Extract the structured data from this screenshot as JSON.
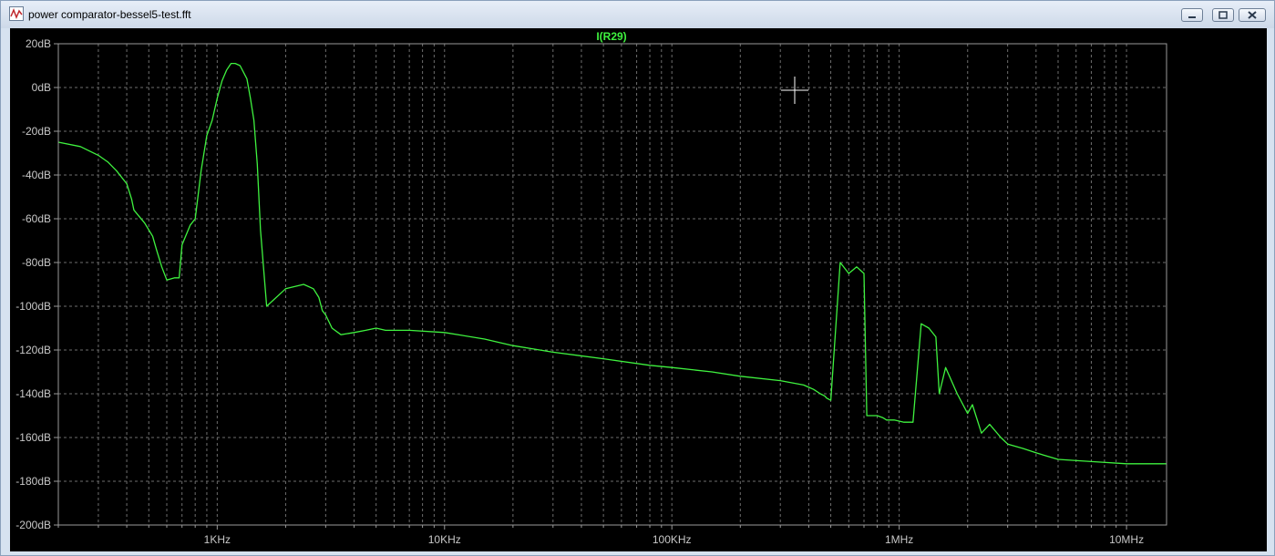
{
  "window": {
    "title": "power comparator-bessel5-test.fft"
  },
  "icons": {
    "app": "waveform-viewer-icon",
    "minimize": "minimize-icon",
    "maximize": "maximize-icon",
    "close": "close-icon"
  },
  "colors": {
    "background": "#000000",
    "trace": "#3ff23f",
    "axis_text": "#c8c8c8",
    "grid": "#6e6e6e",
    "cursor": "#ffffff"
  },
  "chart_data": {
    "type": "line",
    "title": "I(R29)",
    "x_scale": "log",
    "xlim": [
      200,
      15000000
    ],
    "ylim": [
      -200,
      20
    ],
    "y_ticks": [
      20,
      0,
      -20,
      -40,
      -60,
      -80,
      -100,
      -120,
      -140,
      -160,
      -180,
      -200
    ],
    "y_tick_labels": [
      "20dB",
      "0dB",
      "-20dB",
      "-40dB",
      "-60dB",
      "-80dB",
      "-100dB",
      "-120dB",
      "-140dB",
      "-160dB",
      "-180dB",
      "-200dB"
    ],
    "x_major_ticks": [
      1000,
      10000,
      100000,
      1000000,
      10000000
    ],
    "x_tick_labels": [
      "1KHz",
      "10KHz",
      "100KHz",
      "1MHz",
      "10MHz"
    ],
    "grid": true,
    "series": [
      {
        "name": "I(R29)",
        "x": [
          200,
          250,
          300,
          330,
          360,
          400,
          420,
          430,
          480,
          520,
          540,
          570,
          600,
          650,
          680,
          700,
          760,
          800,
          850,
          900,
          950,
          1000,
          1050,
          1100,
          1150,
          1200,
          1260,
          1350,
          1400,
          1450,
          1500,
          1550,
          1650,
          2000,
          2400,
          2650,
          2800,
          2900,
          3000,
          3200,
          3500,
          4000,
          4500,
          5000,
          5500,
          7000,
          10000,
          15000,
          20000,
          30000,
          50000,
          80000,
          100000,
          150000,
          200000,
          300000,
          380000,
          420000,
          450000,
          470000,
          480000,
          500000,
          550000,
          600000,
          650000,
          700000,
          720000,
          800000,
          850000,
          880000,
          950000,
          1050000,
          1150000,
          1250000,
          1350000,
          1450000,
          1500000,
          1600000,
          1800000,
          2000000,
          2100000,
          2300000,
          2500000,
          2800000,
          3000000,
          3500000,
          4000000,
          5000000,
          7000000,
          10000000,
          15000000
        ],
        "y": [
          -25,
          -27,
          -31,
          -34,
          -38,
          -44,
          -51,
          -56,
          -62,
          -68,
          -74,
          -82,
          -88,
          -87,
          -87,
          -72,
          -63,
          -60,
          -38,
          -22,
          -15,
          -5,
          3,
          8,
          11,
          11,
          10,
          4,
          -5,
          -15,
          -35,
          -65,
          -100,
          -92,
          -90,
          -92,
          -96,
          -102,
          -104,
          -110,
          -113,
          -112,
          -111,
          -110,
          -111,
          -111,
          -112,
          -115,
          -118,
          -121,
          -124,
          -127,
          -128,
          -130,
          -132,
          -134,
          -136,
          -138,
          -140,
          -141,
          -142,
          -143,
          -80,
          -85,
          -82,
          -85,
          -150,
          -150,
          -151,
          -152,
          -152,
          -153,
          -153,
          -108,
          -110,
          -114,
          -140,
          -128,
          -140,
          -149,
          -145,
          -158,
          -154,
          -160,
          -163,
          -165,
          -167,
          -170,
          -171,
          -172,
          -172
        ]
      }
    ],
    "annotations": []
  }
}
